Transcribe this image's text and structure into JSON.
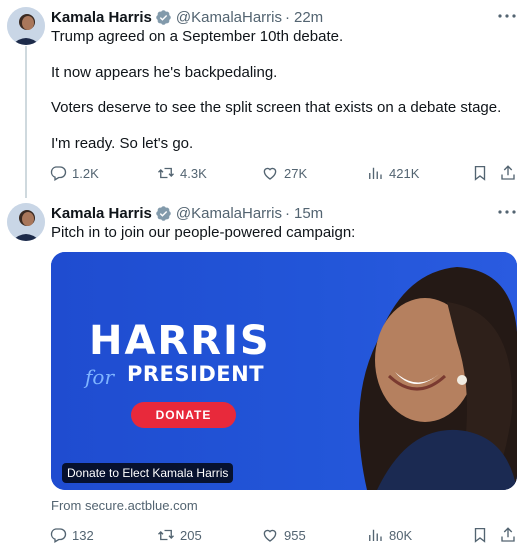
{
  "tweets": [
    {
      "author_name": "Kamala Harris",
      "handle": "@KamalaHarris",
      "separator": "·",
      "time": "22m",
      "lines": [
        "Trump agreed on a September 10th debate.",
        "It now appears he's backpedaling.",
        "Voters deserve to see the split screen that exists on a debate stage.",
        "I'm ready. So let's go."
      ],
      "stats": {
        "replies": "1.2K",
        "reposts": "4.3K",
        "likes": "27K",
        "views": "421K"
      }
    },
    {
      "author_name": "Kamala Harris",
      "handle": "@KamalaHarris",
      "separator": "·",
      "time": "15m",
      "lines": [
        "Pitch in to join our people-powered campaign:"
      ],
      "card": {
        "headline": "HARRIS",
        "for_text": "for",
        "subheadline": "PRESIDENT",
        "button": "DONATE",
        "caption": "Donate to Elect Kamala Harris",
        "source": "From secure.actblue.com"
      },
      "stats": {
        "replies": "132",
        "reposts": "205",
        "likes": "955",
        "views": "80K"
      }
    }
  ],
  "colors": {
    "text_primary": "#0f1419",
    "text_secondary": "#536471",
    "verified_badge": "#829aab",
    "card_blue": "#1f4cd0",
    "donate_red": "#e8293b"
  },
  "icons": [
    "verified-badge-icon",
    "more-icon",
    "reply-icon",
    "repost-icon",
    "like-icon",
    "views-icon",
    "bookmark-icon",
    "share-icon"
  ]
}
